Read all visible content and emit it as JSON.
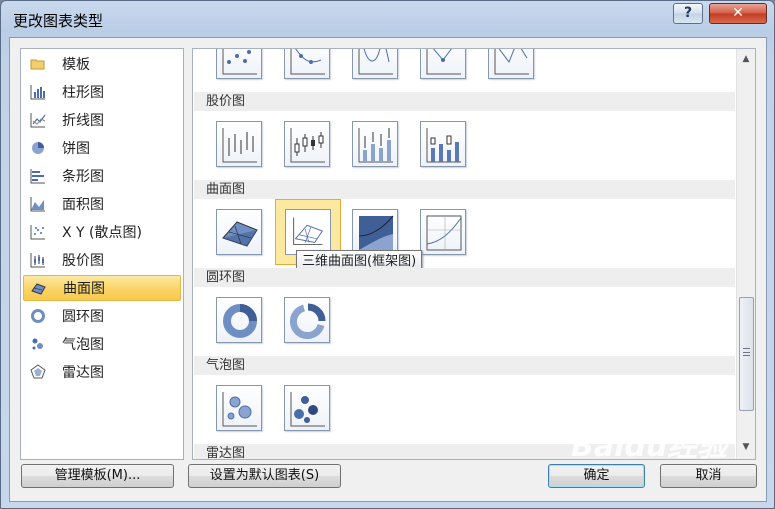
{
  "window": {
    "title": "更改图表类型",
    "help_label": "?",
    "close_label": "✕"
  },
  "categories": [
    {
      "label": "模板",
      "icon": "folder-icon"
    },
    {
      "label": "柱形图",
      "icon": "column-chart-icon"
    },
    {
      "label": "折线图",
      "icon": "line-chart-icon"
    },
    {
      "label": "饼图",
      "icon": "pie-chart-icon"
    },
    {
      "label": "条形图",
      "icon": "bar-chart-icon"
    },
    {
      "label": "面积图",
      "icon": "area-chart-icon"
    },
    {
      "label": "X Y (散点图)",
      "icon": "scatter-chart-icon"
    },
    {
      "label": "股价图",
      "icon": "stock-chart-icon"
    },
    {
      "label": "曲面图",
      "icon": "surface-chart-icon",
      "selected": true
    },
    {
      "label": "圆环图",
      "icon": "doughnut-chart-icon"
    },
    {
      "label": "气泡图",
      "icon": "bubble-chart-icon"
    },
    {
      "label": "雷达图",
      "icon": "radar-chart-icon"
    }
  ],
  "sections": {
    "stock": "股价图",
    "surface": "曲面图",
    "doughnut": "圆环图",
    "bubble": "气泡图",
    "radar": "雷达图"
  },
  "tooltip": "三维曲面图(框架图)",
  "buttons": {
    "manage_templates": "管理模板(M)...",
    "set_default": "设置为默认图表(S)",
    "ok": "确定",
    "cancel": "取消"
  },
  "watermark": "Baidu经验",
  "colors": {
    "accent_blue": "#5a78b4",
    "selection_yellow": "#fbd56a",
    "close_red": "#c23b22"
  }
}
